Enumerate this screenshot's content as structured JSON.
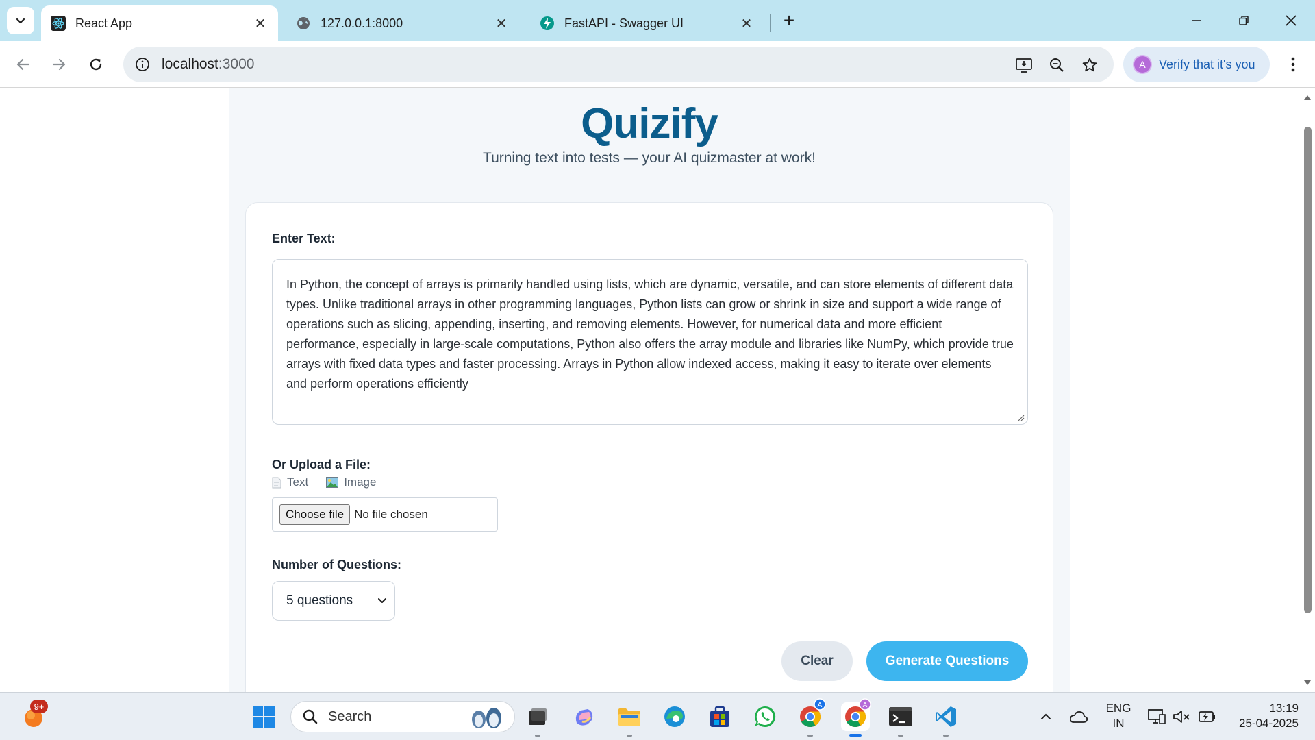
{
  "browser": {
    "tabs": [
      {
        "title": "React App",
        "active": true
      },
      {
        "title": "127.0.0.1:8000",
        "active": false
      },
      {
        "title": "FastAPI - Swagger UI",
        "active": false
      }
    ],
    "address": {
      "host": "localhost",
      "port": ":3000"
    },
    "profile_chip": "Verify that it's you",
    "profile_initial": "A"
  },
  "app": {
    "brand": "Quizify",
    "tagline": "Turning text into tests — your AI quizmaster at work!",
    "text_label": "Enter Text:",
    "text_value": "In Python, the concept of arrays is primarily handled using lists, which are dynamic, versatile, and can store elements of different data types. Unlike traditional arrays in other programming languages, Python lists can grow or shrink in size and support a wide range of operations such as slicing, appending, inserting, and removing elements. However, for numerical data and more efficient performance, especially in large-scale computations, Python also offers the array module and libraries like NumPy, which provide true arrays with fixed data types and faster processing. Arrays in Python allow indexed access, making it easy to iterate over elements and perform operations efficiently",
    "upload_label": "Or Upload a File:",
    "upload_types": [
      "Text",
      "Image"
    ],
    "file_button": "Choose file",
    "file_status": "No file chosen",
    "questions_label": "Number of Questions:",
    "questions_selected": "5 questions",
    "clear_button": "Clear",
    "generate_button": "Generate Questions",
    "accent_color": "#3db5ef",
    "brand_color": "#0b5d8c"
  },
  "taskbar": {
    "notification_badge": "9+",
    "search_placeholder": "Search",
    "language": "ENG",
    "region": "IN",
    "time": "13:19",
    "date": "25-04-2025"
  }
}
